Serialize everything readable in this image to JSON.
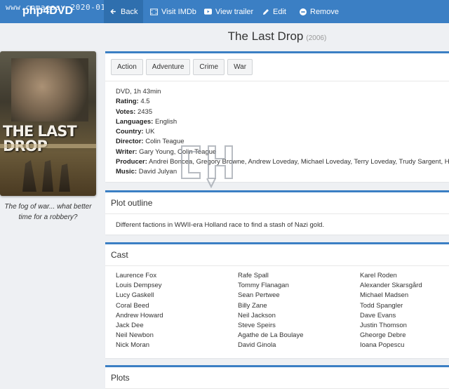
{
  "topbar": {
    "brand": "php4DVD",
    "stamp": "www.cnmaeasy 2020-01-25",
    "nav": [
      {
        "label": "Back",
        "icon": "back-arrow-icon"
      },
      {
        "label": "Visit IMDb",
        "icon": "film-icon"
      },
      {
        "label": "View trailer",
        "icon": "youtube-icon"
      },
      {
        "label": "Edit",
        "icon": "pencil-icon"
      },
      {
        "label": "Remove",
        "icon": "minus-circle-icon"
      }
    ],
    "colors": {
      "bar": "#3b7fc4",
      "active": "#2f6fae"
    }
  },
  "movie": {
    "title": "The Last Drop",
    "year": "(2006)",
    "poster_title": "THE LAST DROP",
    "tagline": "The fog of war... what better time for a robbery?",
    "genres": [
      "Action",
      "Adventure",
      "Crime",
      "War"
    ],
    "format_line": "DVD, 1h 43min",
    "info": {
      "rating": {
        "label": "Rating:",
        "value": "4.5"
      },
      "votes": {
        "label": "Votes:",
        "value": "2435"
      },
      "languages": {
        "label": "Languages:",
        "value": "English"
      },
      "country": {
        "label": "Country:",
        "value": "UK"
      },
      "director": {
        "label": "Director:",
        "value": "Colin Teague"
      },
      "writer": {
        "label": "Writer:",
        "value": "Gary Young, Colin Teague"
      },
      "producer": {
        "label": "Producer:",
        "value": "Andrei Boncea, Gregory Browne, Andrew Loveday, Michael Loveday, Terry Loveday, Trudy Sargent, Hami"
      },
      "music": {
        "label": "Music:",
        "value": "David Julyan"
      }
    }
  },
  "plot_outline": {
    "heading": "Plot outline",
    "text": "Different factions in WWII-era Holland race to find a stash of Nazi gold."
  },
  "cast": {
    "heading": "Cast",
    "columns": [
      [
        "Laurence Fox",
        "Louis Dempsey",
        "Lucy Gaskell",
        "Coral Beed",
        "Andrew Howard",
        "Jack Dee",
        "Neil Newbon",
        "Nick Moran"
      ],
      [
        "Rafe Spall",
        "Tommy Flanagan",
        "Sean Pertwee",
        "Billy Zane",
        "Neil Jackson",
        "Steve Speirs",
        "Agathe de La Boulaye",
        "David Ginola"
      ],
      [
        "Karel Roden",
        "Alexander Skarsgård",
        "Michael Madsen",
        "Todd Spangler",
        "Dave Evans",
        "Justin Thomson",
        "Gheorge Debre",
        "Ioana Popescu"
      ]
    ]
  },
  "plots": {
    "heading": "Plots"
  }
}
